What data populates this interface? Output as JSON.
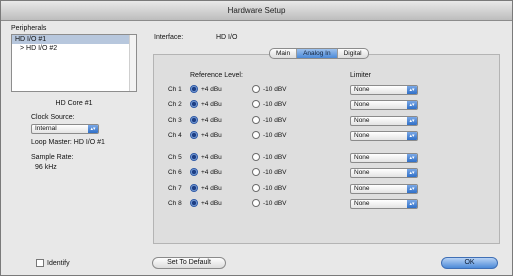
{
  "window": {
    "title": "Hardware Setup"
  },
  "left": {
    "peripherals_label": "Peripherals",
    "peripherals": [
      {
        "label": "HD I/O #1",
        "selected": true
      },
      {
        "label": "> HD I/O #2",
        "selected": false
      }
    ],
    "core_label": "HD Core #1",
    "clock_source_label": "Clock Source:",
    "clock_source_value": "Internal",
    "loop_master": "Loop Master: HD I/O #1",
    "sample_rate_label": "Sample Rate:",
    "sample_rate_value": "96 kHz",
    "identify_label": "Identify",
    "identify_checked": false
  },
  "main": {
    "interface_label": "Interface:",
    "interface_value": "HD I/O",
    "tabs": [
      {
        "label": "Main",
        "active": false
      },
      {
        "label": "Analog In",
        "active": true
      },
      {
        "label": "Digital",
        "active": false
      }
    ],
    "reference_level_label": "Reference Level:",
    "limiter_label": "Limiter",
    "channels": [
      {
        "ch": "Ch 1",
        "opt1": "+4 dBu",
        "opt2": "-10 dBV",
        "selected": "+4 dBu",
        "limiter": "None"
      },
      {
        "ch": "Ch 2",
        "opt1": "+4 dBu",
        "opt2": "-10 dBV",
        "selected": "+4 dBu",
        "limiter": "None"
      },
      {
        "ch": "Ch 3",
        "opt1": "+4 dBu",
        "opt2": "-10 dBV",
        "selected": "+4 dBu",
        "limiter": "None"
      },
      {
        "ch": "Ch 4",
        "opt1": "+4 dBu",
        "opt2": "-10 dBV",
        "selected": "+4 dBu",
        "limiter": "None"
      },
      {
        "ch": "Ch 5",
        "opt1": "+4 dBu",
        "opt2": "-10 dBV",
        "selected": "+4 dBu",
        "limiter": "None"
      },
      {
        "ch": "Ch 6",
        "opt1": "+4 dBu",
        "opt2": "-10 dBV",
        "selected": "+4 dBu",
        "limiter": "None"
      },
      {
        "ch": "Ch 7",
        "opt1": "+4 dBu",
        "opt2": "-10 dBV",
        "selected": "+4 dBu",
        "limiter": "None"
      },
      {
        "ch": "Ch 8",
        "opt1": "+4 dBu",
        "opt2": "-10 dBV",
        "selected": "+4 dBu",
        "limiter": "None"
      }
    ],
    "set_default_label": "Set To Default",
    "ok_label": "OK"
  },
  "icons": {
    "select_arrows": "updown-arrows-icon",
    "radio": "radio-button-icon"
  },
  "colors": {
    "accent": "#4c8ad8",
    "selection": "#b7c7dd"
  }
}
